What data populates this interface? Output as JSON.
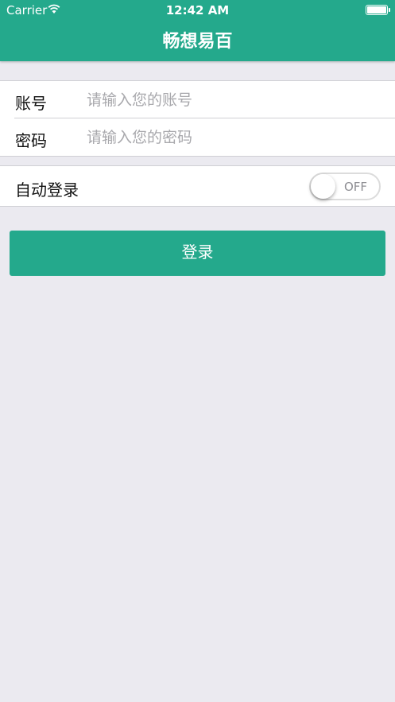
{
  "status_bar": {
    "carrier": "Carrier",
    "time": "12:42 AM",
    "wifi_icon": "wifi-icon",
    "battery_icon": "battery-icon"
  },
  "nav": {
    "title": "畅想易百"
  },
  "form": {
    "account": {
      "label": "账号",
      "placeholder": "请输入您的账号",
      "value": ""
    },
    "password": {
      "label": "密码",
      "placeholder": "请输入您的密码",
      "value": ""
    }
  },
  "auto_login": {
    "label": "自动登录",
    "toggle_state": "OFF"
  },
  "login_button": {
    "label": "登录"
  },
  "colors": {
    "primary": "#24a98c",
    "background": "#ebeaf0",
    "placeholder": "#a8a8ac"
  }
}
